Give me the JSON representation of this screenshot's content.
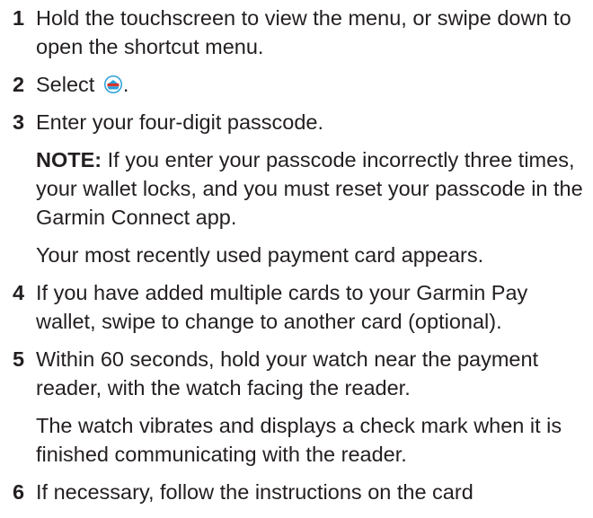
{
  "steps": [
    {
      "number": "1",
      "text": "Hold the touchscreen to view the menu, or swipe down to open the shortcut menu."
    },
    {
      "number": "2",
      "text_before": "Select",
      "icon": "wallet-icon",
      "text_after": "."
    },
    {
      "number": "3",
      "text": "Enter your four-digit passcode.",
      "note_label": "NOTE:",
      "note_text": "If you enter your passcode incorrectly three times, your wallet locks, and you must reset your passcode in the Garmin Connect app.",
      "result": "Your most recently used payment card appears."
    },
    {
      "number": "4",
      "text": "If you have added multiple cards to your Garmin Pay wallet, swipe to change to another card (optional)."
    },
    {
      "number": "5",
      "text": "Within 60 seconds, hold your watch near the payment reader, with the watch facing the reader.",
      "result": "The watch vibrates and displays a check mark when it is finished communicating with the reader."
    },
    {
      "number": "6",
      "text": "If necessary, follow the instructions on the card"
    }
  ],
  "colors": {
    "text": "#231f20",
    "icon_blue": "#2a9fd8",
    "icon_red": "#d9342b"
  }
}
